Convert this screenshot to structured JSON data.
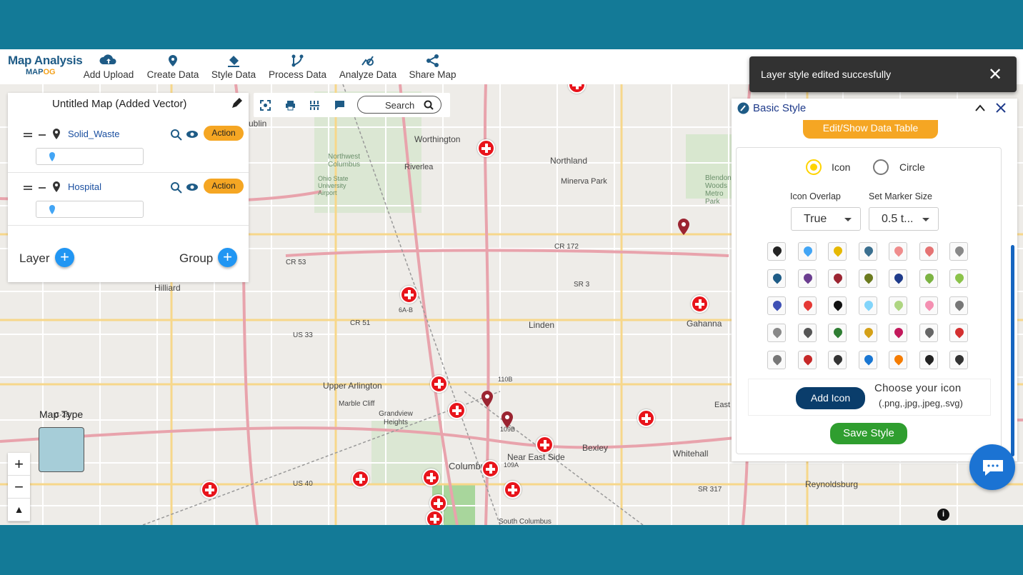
{
  "app": {
    "title_line1": "Map Analysis",
    "title_line2_a": "MAP",
    "title_line2_b": "OG"
  },
  "toolbar": {
    "items": [
      {
        "label": "Add Upload",
        "icon": "cloud-upload-icon"
      },
      {
        "label": "Create Data",
        "icon": "location-pin-icon"
      },
      {
        "label": "Style Data",
        "icon": "paint-bucket-icon"
      },
      {
        "label": "Process Data",
        "icon": "process-icon"
      },
      {
        "label": "Analyze Data",
        "icon": "analyze-icon"
      },
      {
        "label": "Share Map",
        "icon": "share-icon"
      }
    ]
  },
  "layer_panel": {
    "map_title": "Untitled Map (Added Vector)",
    "layers": [
      {
        "name": "Solid_Waste",
        "action_label": "Action"
      },
      {
        "name": "Hospital",
        "action_label": "Action"
      }
    ],
    "layer_label": "Layer",
    "group_label": "Group"
  },
  "map_bar": {
    "search_label": "Search"
  },
  "toast": {
    "message": "Layer style edited succesfully",
    "close": "✕"
  },
  "style_panel": {
    "title": "Basic Style",
    "edit_data_button": "Edit/Show Data Table",
    "radio_icon": "Icon",
    "radio_circle": "Circle",
    "icon_overlap_label": "Icon Overlap",
    "icon_overlap_value": "True",
    "marker_size_label": "Set Marker Size",
    "marker_size_value": "0.5 t...",
    "add_icon_button": "Add Icon",
    "choose_icon_text": "Choose your icon",
    "choose_icon_formats": "(.png,.jpg,.jpeg,.svg)",
    "save_button": "Save Style"
  },
  "map_controls": {
    "zoom_in": "+",
    "zoom_out": "−",
    "map_type_label": "Map Type"
  },
  "map_labels": [
    "Worthington",
    "Northwest Columbus",
    "Riverlea",
    "Northland",
    "Minerva Park",
    "Blendon Woods Metro Park",
    "Hilliard",
    "Linden",
    "Gahanna",
    "Upper Arlington",
    "Marble Cliff",
    "Grandview Heights",
    "Columbus",
    "Near East Side",
    "Bexley",
    "Whitehall",
    "Reynoldsburg",
    "South Columbus",
    "Ohio State University Airport",
    "East Columbus",
    "ublin"
  ],
  "road_labels": [
    "CR 53",
    "CR 172",
    "SR 3",
    "US 33",
    "CR 51",
    "US 40",
    "SR 317",
    "C-28",
    "6A-B",
    "110B",
    "109A",
    "109B"
  ],
  "colors": {
    "accent_orange": "#f5a623",
    "brand_blue": "#1e5b86",
    "hospital_red": "#e8141b",
    "frame_teal": "#137a97"
  }
}
